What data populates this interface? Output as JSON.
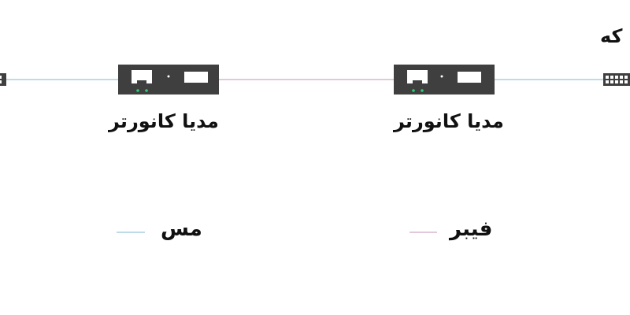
{
  "diagram": {
    "top_right_label": "که",
    "converters": [
      {
        "label": "مدیا کانورتر"
      },
      {
        "label": "مدیا کانورتر"
      }
    ],
    "legend": [
      {
        "label": "مس",
        "color": "#a9cfe0"
      },
      {
        "label": "فیبر",
        "color": "#d8b6cf"
      }
    ]
  },
  "colors": {
    "copper_line": "#a9cfe0",
    "fiber_line": "#d8b6cf",
    "device_body": "#3f3f3f",
    "port_fill": "#ffffff",
    "led": "#2ecc71"
  }
}
